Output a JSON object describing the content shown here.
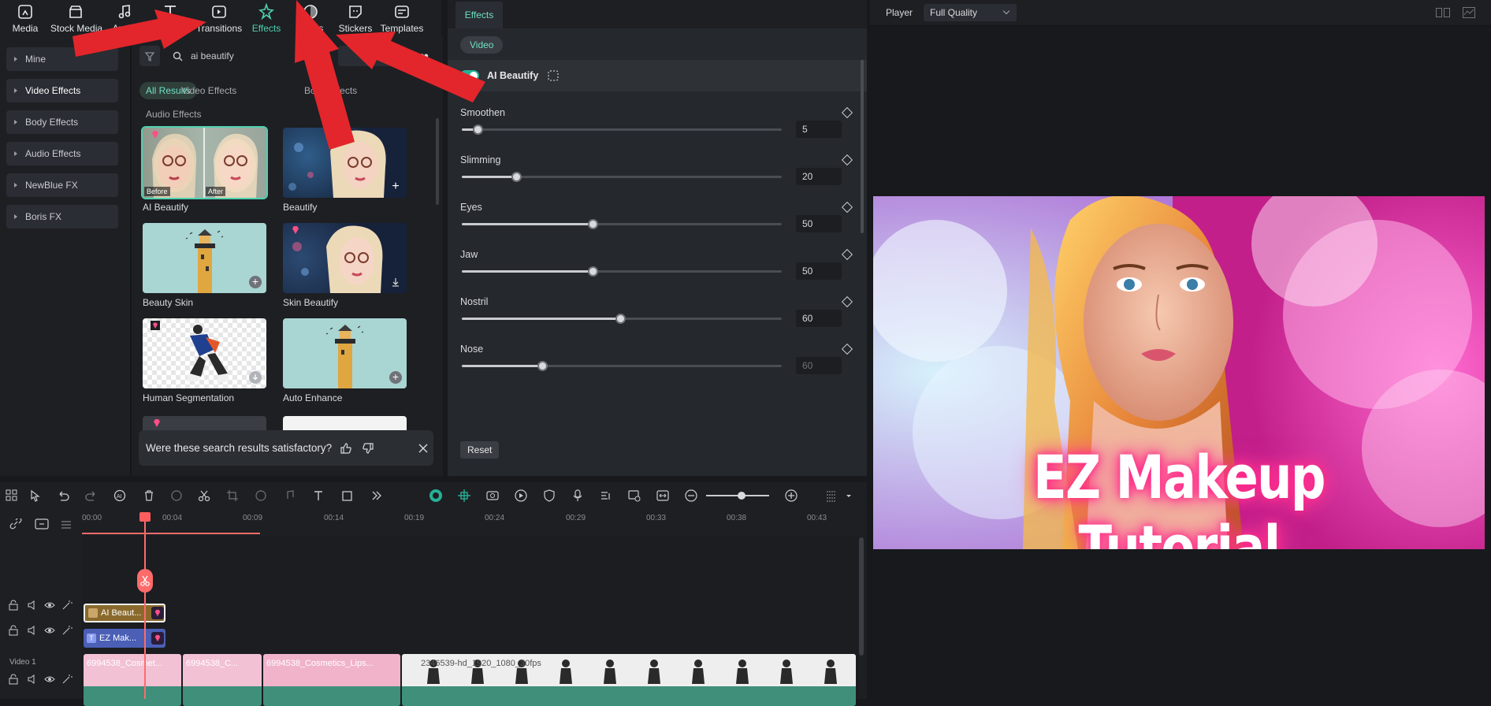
{
  "toolbar": {
    "items": [
      {
        "label": "Media",
        "icon": "media-icon"
      },
      {
        "label": "Stock Media",
        "icon": "stock-media-icon"
      },
      {
        "label": "Audio",
        "icon": "music-note-icon"
      },
      {
        "label": "Titles",
        "icon": "text-t-icon"
      },
      {
        "label": "Transitions",
        "icon": "transitions-icon"
      },
      {
        "label": "Effects",
        "icon": "effects-icon",
        "active": true
      },
      {
        "label": "Filters",
        "icon": "filters-icon"
      },
      {
        "label": "Stickers",
        "icon": "stickers-icon"
      },
      {
        "label": "Templates",
        "icon": "templates-icon"
      }
    ],
    "accent": "#4fd1b0"
  },
  "sidebar": {
    "items": [
      {
        "label": "Mine"
      },
      {
        "label": "Video Effects",
        "active": true
      },
      {
        "label": "Body Effects"
      },
      {
        "label": "Audio Effects"
      },
      {
        "label": "NewBlue FX"
      },
      {
        "label": "Boris FX"
      }
    ]
  },
  "results": {
    "search_value": "ai beautify",
    "tabs": [
      "All Results",
      "Video Effects",
      "Body Effects",
      "Audio Effects"
    ],
    "cards": [
      {
        "label": "AI Beautify",
        "before": "Before",
        "after": "After"
      },
      {
        "label": "Beautify"
      },
      {
        "label": "Beauty Skin"
      },
      {
        "label": "Skin Beautify"
      },
      {
        "label": "Human Segmentation"
      },
      {
        "label": "Auto Enhance"
      }
    ],
    "feedback_text": "Were these search results satisfactory?"
  },
  "props": {
    "tab": "Effects",
    "pill": "Video",
    "effect_name": "AI Beautify",
    "params": [
      {
        "label": "Smoothen",
        "value": "5",
        "fraction": 0.05
      },
      {
        "label": "Slimming",
        "value": "20",
        "fraction": 0.17
      },
      {
        "label": "Eyes",
        "value": "50",
        "fraction": 0.41
      },
      {
        "label": "Jaw",
        "value": "50",
        "fraction": 0.41
      },
      {
        "label": "Nostril",
        "value": "60",
        "fraction": 0.495
      },
      {
        "label": "Nose",
        "value": "60",
        "fraction": 0.25
      }
    ],
    "reset_label": "Reset"
  },
  "player": {
    "label": "Player",
    "quality": "Full Quality",
    "preview_title": "EZ Makeup Tutorial"
  },
  "timeline": {
    "ticks": [
      "00:00",
      "00:04",
      "00:09",
      "00:14",
      "00:19",
      "00:24",
      "00:29",
      "00:33",
      "00:38",
      "00:43"
    ],
    "video_track_label": "Video 1",
    "effect_clip_label": "AI Beaut...",
    "title_clip_label": "EZ Mak...",
    "video_clips": [
      "6994538_Cosmet...",
      "6994538_C...",
      "6994538_Cosmetics_Lips...",
      "2346539-hd_1920_1080_30fps"
    ]
  }
}
